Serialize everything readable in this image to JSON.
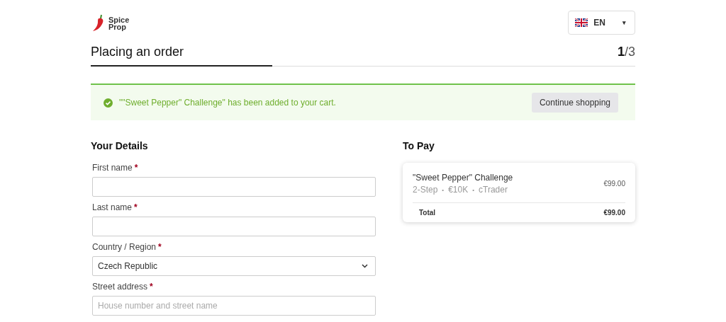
{
  "logo": {
    "text": "Spice Prop"
  },
  "language": {
    "label": "EN",
    "caret": "▾"
  },
  "header": {
    "title": "Placing an order",
    "step": "1",
    "total": "/3",
    "level": 0.333
  },
  "notice": {
    "message": "\"\"Sweet Pepper\" Challenge\" has been added to your cart.",
    "button": "Continue shopping"
  },
  "details": {
    "heading": "Your Details",
    "fields": [
      {
        "kind": "text",
        "label": "First name",
        "required_mark": "*"
      },
      {
        "kind": "text",
        "label": "Last name",
        "required_mark": "*"
      },
      {
        "kind": "select",
        "label": "Country / Region",
        "required_mark": "*",
        "value": "Czech Republic"
      },
      {
        "kind": "text",
        "label": "Street address",
        "required_mark": "*",
        "placeholder": "House number and street name"
      }
    ]
  },
  "summary": {
    "heading": "To Pay",
    "item": {
      "name": "\"Sweet Pepper\" Challenge",
      "options": [
        "2-Step",
        "€10K",
        "cTrader"
      ],
      "separator": "•",
      "price": "€99.00"
    },
    "total_label": "Total",
    "total": "€99.00"
  }
}
